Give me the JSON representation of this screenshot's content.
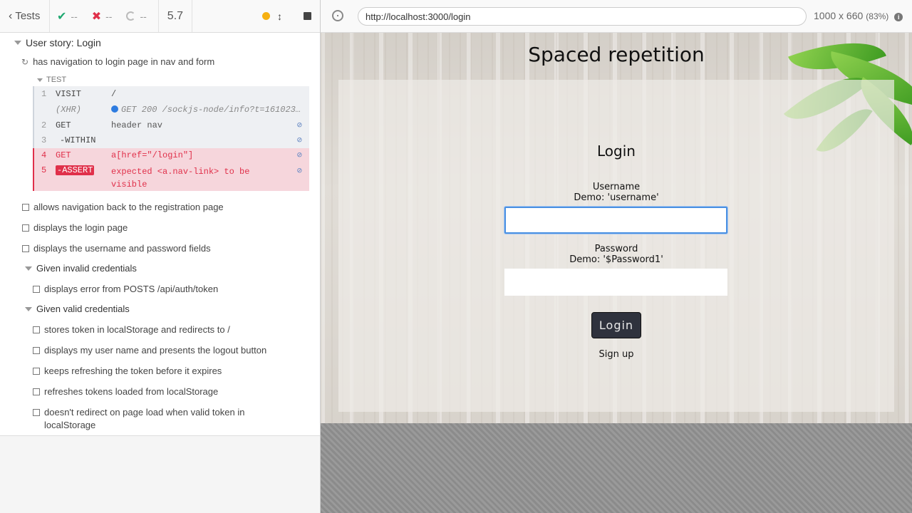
{
  "header": {
    "tests_label": "Tests",
    "passed": "--",
    "failed": "--",
    "pending": "--",
    "duration": "5.7"
  },
  "suite": {
    "title": "User story: Login",
    "running_test": "has navigation to login page in nav and form",
    "test_section_label": "TEST",
    "commands": [
      {
        "num": "1",
        "name": "VISIT",
        "message": "/"
      },
      {
        "num": "",
        "name": "(XHR)",
        "message": "GET 200 /sockjs-node/info?t=161023…"
      },
      {
        "num": "2",
        "name": "GET",
        "message": "header nav"
      },
      {
        "num": "3",
        "name": "-WITHIN",
        "message": ""
      },
      {
        "num": "4",
        "name": "GET",
        "message": "a[href=\"/login\"]"
      },
      {
        "num": "5",
        "name": "-ASSERT",
        "message_line1": "expected <a.nav-link> to be",
        "message_line2": "visible"
      }
    ],
    "tests": [
      "allows navigation back to the registration page",
      "displays the login page",
      "displays the username and password fields"
    ],
    "groups": [
      {
        "title": "Given invalid credentials",
        "tests": [
          "displays error from POSTS /api/auth/token"
        ]
      },
      {
        "title": "Given valid credentials",
        "tests": [
          "stores token in localStorage and redirects to /",
          "displays my user name and presents the logout button",
          "keeps refreshing the token before it expires",
          "refreshes tokens loaded from localStorage",
          "doesn't redirect on page load when valid token in",
          "localStorage"
        ]
      }
    ]
  },
  "urlbar": {
    "url": "http://localhost:3000/login",
    "viewport": "1000 x 660",
    "scale": "(83%)"
  },
  "app": {
    "title": "Spaced repetition",
    "heading": "Login",
    "username_label": "Username",
    "username_demo": "Demo: 'username'",
    "password_label": "Password",
    "password_demo": "Demo: '$Password1'",
    "login_button": "Login",
    "signup_link": "Sign up"
  },
  "colors": {
    "pass": "#1ea870",
    "fail": "#e0304a",
    "focus": "#4a90e2",
    "running": "#f6b011"
  }
}
